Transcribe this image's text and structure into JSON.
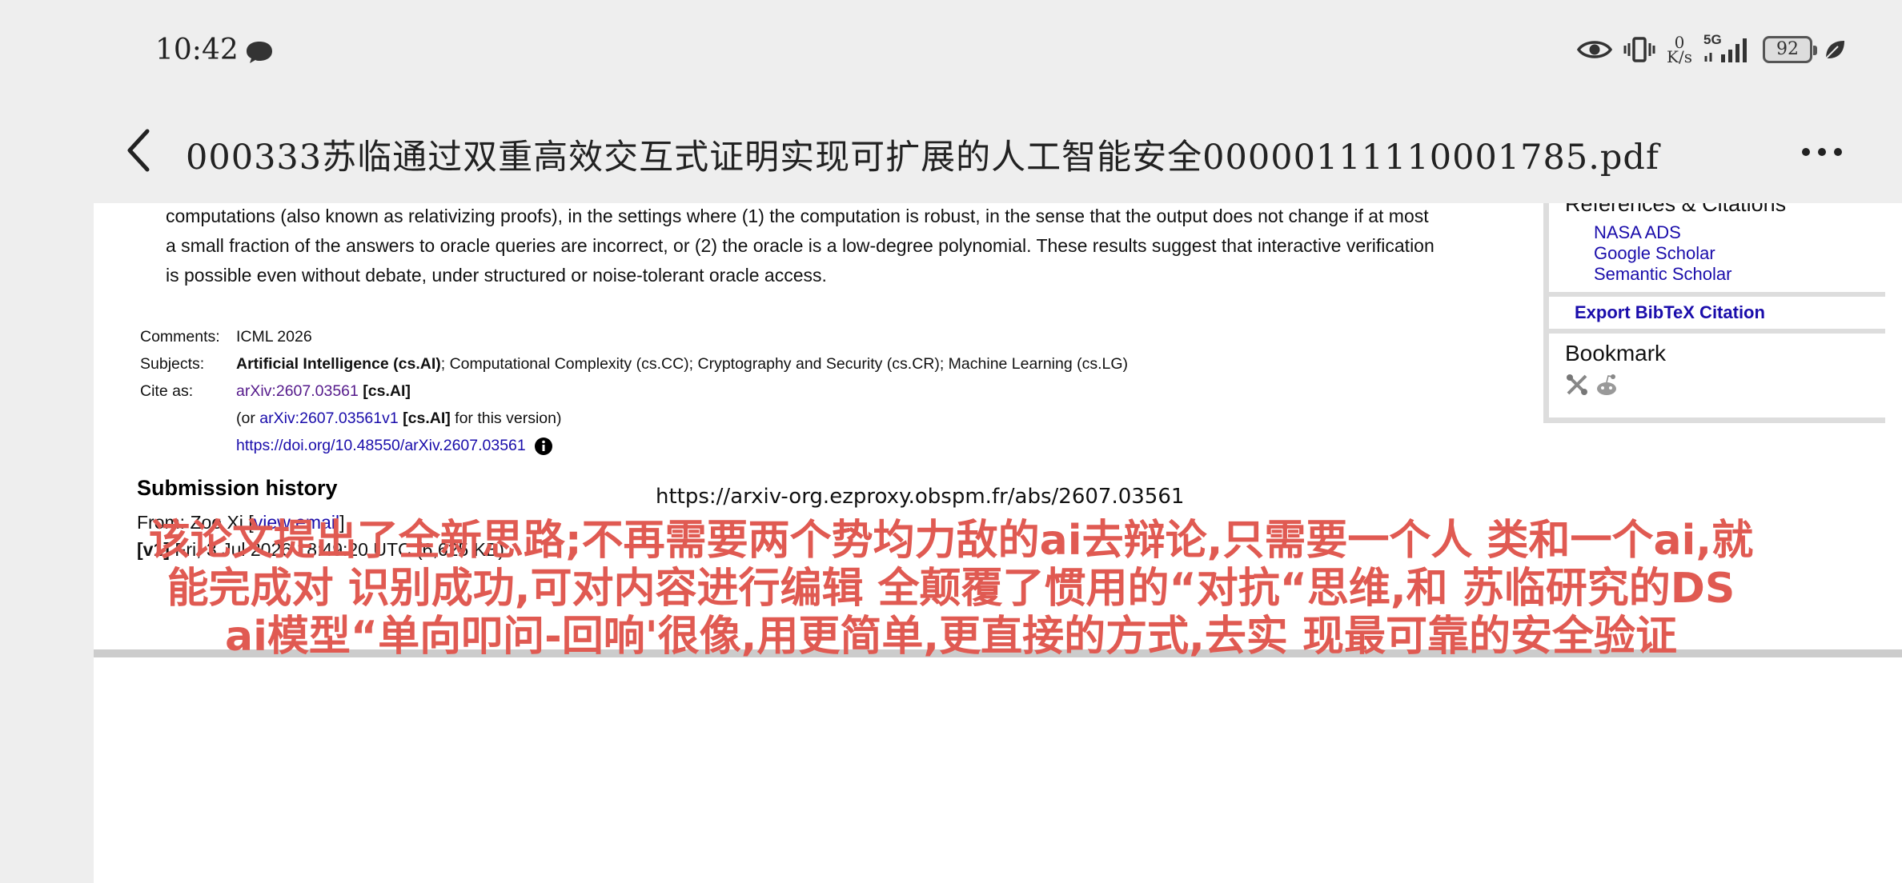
{
  "status_bar": {
    "time": "10:42",
    "net_speed_value": "0",
    "net_speed_unit": "K/s",
    "network": "5G",
    "battery": "92"
  },
  "title_bar": {
    "title": "000333苏临通过双重高效交互式证明实现可扩展的人工智能安全00000111110001785.pdf"
  },
  "abstract": {
    "line1": "computations (also known as relativizing proofs), in the settings where (1) the computation is robust, in the sense that the output does not change if at most",
    "line2": "a small fraction of the answers to oracle queries are incorrect, or (2) the oracle is a low-degree polynomial. These results suggest that interactive verification",
    "line3": "is possible even without debate, under structured or noise-tolerant oracle access."
  },
  "meta": {
    "comments_label": "Comments:",
    "comments_value": "ICML 2026",
    "subjects_label": "Subjects:",
    "subjects_primary": "Artificial Intelligence (cs.AI)",
    "subjects_rest": "; Computational Complexity (cs.CC); Cryptography and Security (cs.CR); Machine Learning (cs.LG)",
    "cite_label": "Cite as:",
    "cite_id": "arXiv:2607.03561",
    "cite_tag": "[cs.AI]",
    "cite_alt_prefix": "(or ",
    "cite_alt_id": "arXiv:2607.03561v1",
    "cite_alt_tag": "[cs.AI]",
    "cite_alt_suffix": " for this version)",
    "doi": "https://doi.org/10.48550/arXiv.2607.03561"
  },
  "submission": {
    "heading": "Submission history",
    "from_prefix": "From: Zoe Xi [",
    "view_email": "view email",
    "from_suffix": "]",
    "version": "[v1]",
    "version_detail": " Fri, 3 Jul 2026 18:49:20 UTC (6,625 KB)"
  },
  "url_overlay": "https://arxiv-org.ezproxy.obspm.fr/abs/2607.03561",
  "sidebar": {
    "heading": "References & Citations",
    "links": [
      "NASA ADS",
      "Google Scholar",
      "Semantic Scholar"
    ],
    "bibtex": "Export BibTeX Citation",
    "bookmark": "Bookmark"
  },
  "caption": {
    "line1": "该论文提出了全新思路;不再需要两个势均力敌的ai去辩论,只需要一个人 类和一个ai,就",
    "line2": "能完成对 识别成功,可对内容进行编辑 全颠覆了惯用的“对抗“思维,和 苏临研究的DS",
    "line3": "ai模型“单向叩问-回响'很像,用更简单,更直接的方式,去实 现最可靠的安全验证"
  }
}
